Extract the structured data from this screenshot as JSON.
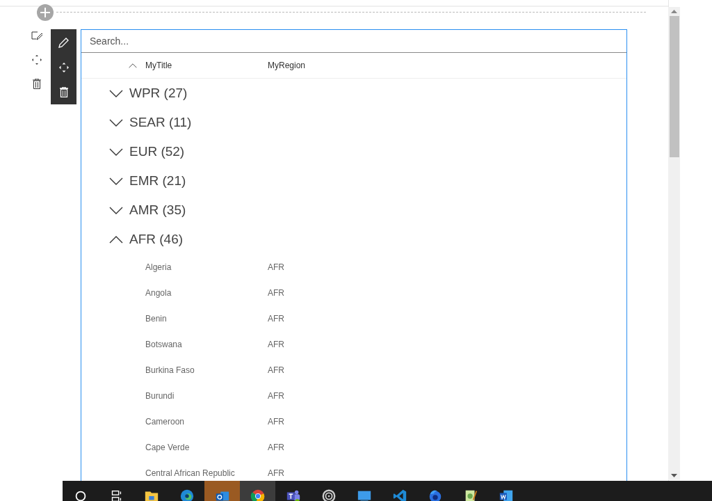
{
  "search": {
    "placeholder": "Search..."
  },
  "columns": [
    {
      "label": "MyTitle",
      "sorted_ascending": true
    },
    {
      "label": "MyRegion"
    }
  ],
  "groups": [
    {
      "label": "WPR (27)",
      "expanded": false
    },
    {
      "label": "SEAR (11)",
      "expanded": false
    },
    {
      "label": "EUR (52)",
      "expanded": false
    },
    {
      "label": "EMR (21)",
      "expanded": false
    },
    {
      "label": "AMR (35)",
      "expanded": false
    },
    {
      "label": "AFR (46)",
      "expanded": true,
      "rows": [
        {
          "title": "Algeria",
          "region": "AFR"
        },
        {
          "title": "Angola",
          "region": "AFR"
        },
        {
          "title": "Benin",
          "region": "AFR"
        },
        {
          "title": "Botswana",
          "region": "AFR"
        },
        {
          "title": "Burkina Faso",
          "region": "AFR"
        },
        {
          "title": "Burundi",
          "region": "AFR"
        },
        {
          "title": "Cameroon",
          "region": "AFR"
        },
        {
          "title": "Cape Verde",
          "region": "AFR"
        },
        {
          "title": "Central African Republic",
          "region": "AFR"
        }
      ]
    }
  ],
  "taskbar": [
    {
      "kind": "search",
      "selected": false,
      "hovered": false
    },
    {
      "kind": "taskview",
      "selected": false,
      "hovered": false
    },
    {
      "kind": "folder",
      "selected": false,
      "hovered": false
    },
    {
      "kind": "browser",
      "selected": false,
      "hovered": false
    },
    {
      "kind": "mail",
      "selected": true,
      "hovered": false
    },
    {
      "kind": "globe",
      "selected": false,
      "hovered": true
    },
    {
      "kind": "team",
      "selected": false,
      "hovered": false
    },
    {
      "kind": "ring",
      "selected": false,
      "hovered": false
    },
    {
      "kind": "screen",
      "selected": false,
      "hovered": false
    },
    {
      "kind": "code",
      "selected": false,
      "hovered": false
    },
    {
      "kind": "fox",
      "selected": false,
      "hovered": false
    },
    {
      "kind": "notepad",
      "selected": false,
      "hovered": false
    },
    {
      "kind": "word",
      "selected": false,
      "hovered": false
    }
  ]
}
